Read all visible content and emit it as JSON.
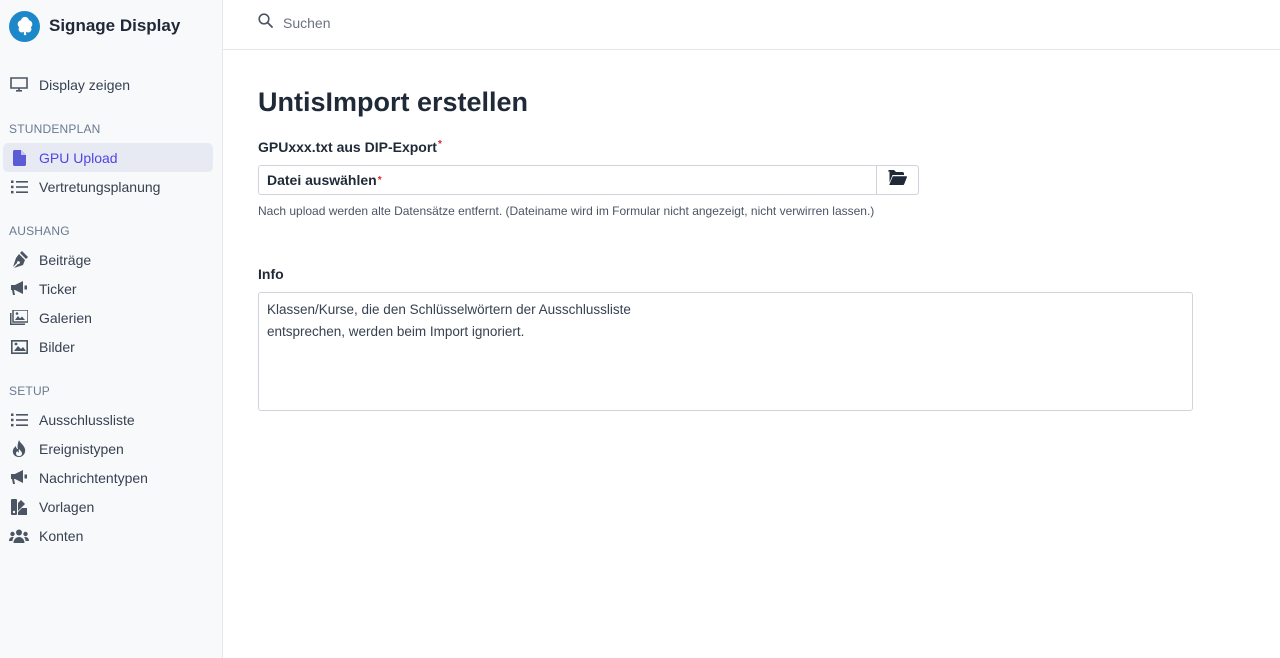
{
  "brand": {
    "name": "Signage Display",
    "icon": "tree-icon",
    "color": "#1d88c9"
  },
  "search": {
    "placeholder": "Suchen",
    "icon": "search-icon"
  },
  "sidebar": {
    "top_items": [
      {
        "label": "Display zeigen",
        "icon": "monitor-icon"
      }
    ],
    "sections": [
      {
        "label": "STUNDENPLAN",
        "items": [
          {
            "label": "GPU Upload",
            "icon": "file-icon",
            "active": true
          },
          {
            "label": "Vertretungsplanung",
            "icon": "list-icon"
          }
        ]
      },
      {
        "label": "AUSHANG",
        "items": [
          {
            "label": "Beiträge",
            "icon": "pen-nib-icon"
          },
          {
            "label": "Ticker",
            "icon": "megaphone-icon"
          },
          {
            "label": "Galerien",
            "icon": "images-icon"
          },
          {
            "label": "Bilder",
            "icon": "image-icon"
          }
        ]
      },
      {
        "label": "SETUP",
        "items": [
          {
            "label": "Ausschlussliste",
            "icon": "list-icon"
          },
          {
            "label": "Ereignistypen",
            "icon": "fire-icon"
          },
          {
            "label": "Nachrichtentypen",
            "icon": "megaphone-icon"
          },
          {
            "label": "Vorlagen",
            "icon": "swatchbook-icon"
          },
          {
            "label": "Konten",
            "icon": "users-icon"
          }
        ]
      }
    ]
  },
  "main": {
    "title": "UntisImport erstellen",
    "file_field": {
      "label": "GPUxxx.txt aus DIP-Export",
      "required_mark": "*",
      "placeholder": "Datei auswählen",
      "button_icon": "folder-open-icon",
      "help": "Nach upload werden alte Datensätze entfernt. (Dateiname wird im Formular nicht angezeigt, nicht verwirren lassen.)"
    },
    "info": {
      "label": "Info",
      "lines": [
        "Klassen/Kurse, die den Schlüsselwörtern der Ausschlussliste",
        "entsprechen, werden beim Import ignoriert."
      ]
    }
  },
  "colors": {
    "active": "#4f46e5",
    "active_bg": "#e8eaf3",
    "required": "#dc2626"
  }
}
